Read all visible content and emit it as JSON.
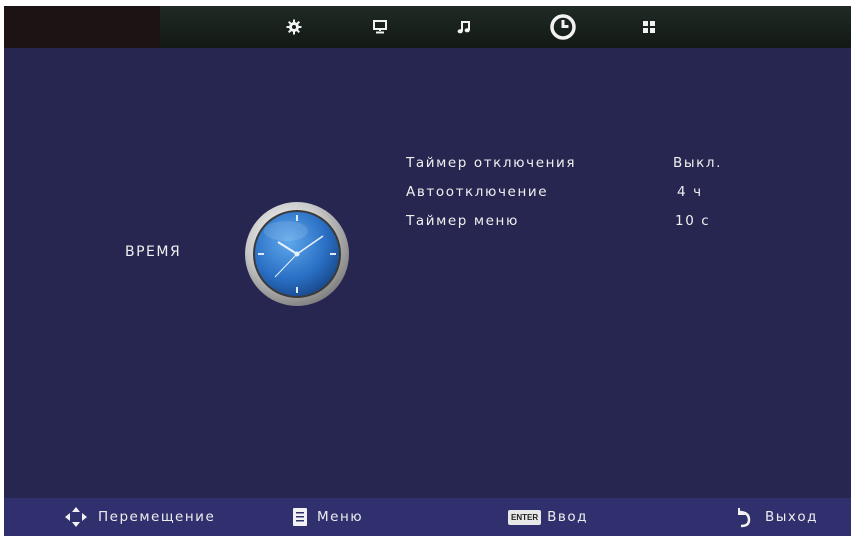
{
  "topbar": {
    "tabs": [
      {
        "icon": "settings-gear-icon"
      },
      {
        "icon": "monitor-icon"
      },
      {
        "icon": "music-note-icon"
      },
      {
        "icon": "clock-icon",
        "active": true
      },
      {
        "icon": "grid-icon"
      }
    ]
  },
  "section": {
    "title": "ВРЕМЯ",
    "icon": "analog-clock-icon"
  },
  "menu": {
    "items": [
      {
        "label": "Таймер отключения",
        "value": "Выкл."
      },
      {
        "label": "Автоотключение",
        "value": "4 ч"
      },
      {
        "label": "Таймер меню",
        "value": "10 с"
      }
    ]
  },
  "bottombar": {
    "move_label": "Перемещение",
    "menu_label": "Меню",
    "enter_badge": "ENTER",
    "enter_label": "Ввод",
    "exit_label": "Выход"
  },
  "colors": {
    "background": "#262651",
    "bottombar": "#30306e",
    "topbar": "#131915",
    "text": "#f0f0f0"
  }
}
